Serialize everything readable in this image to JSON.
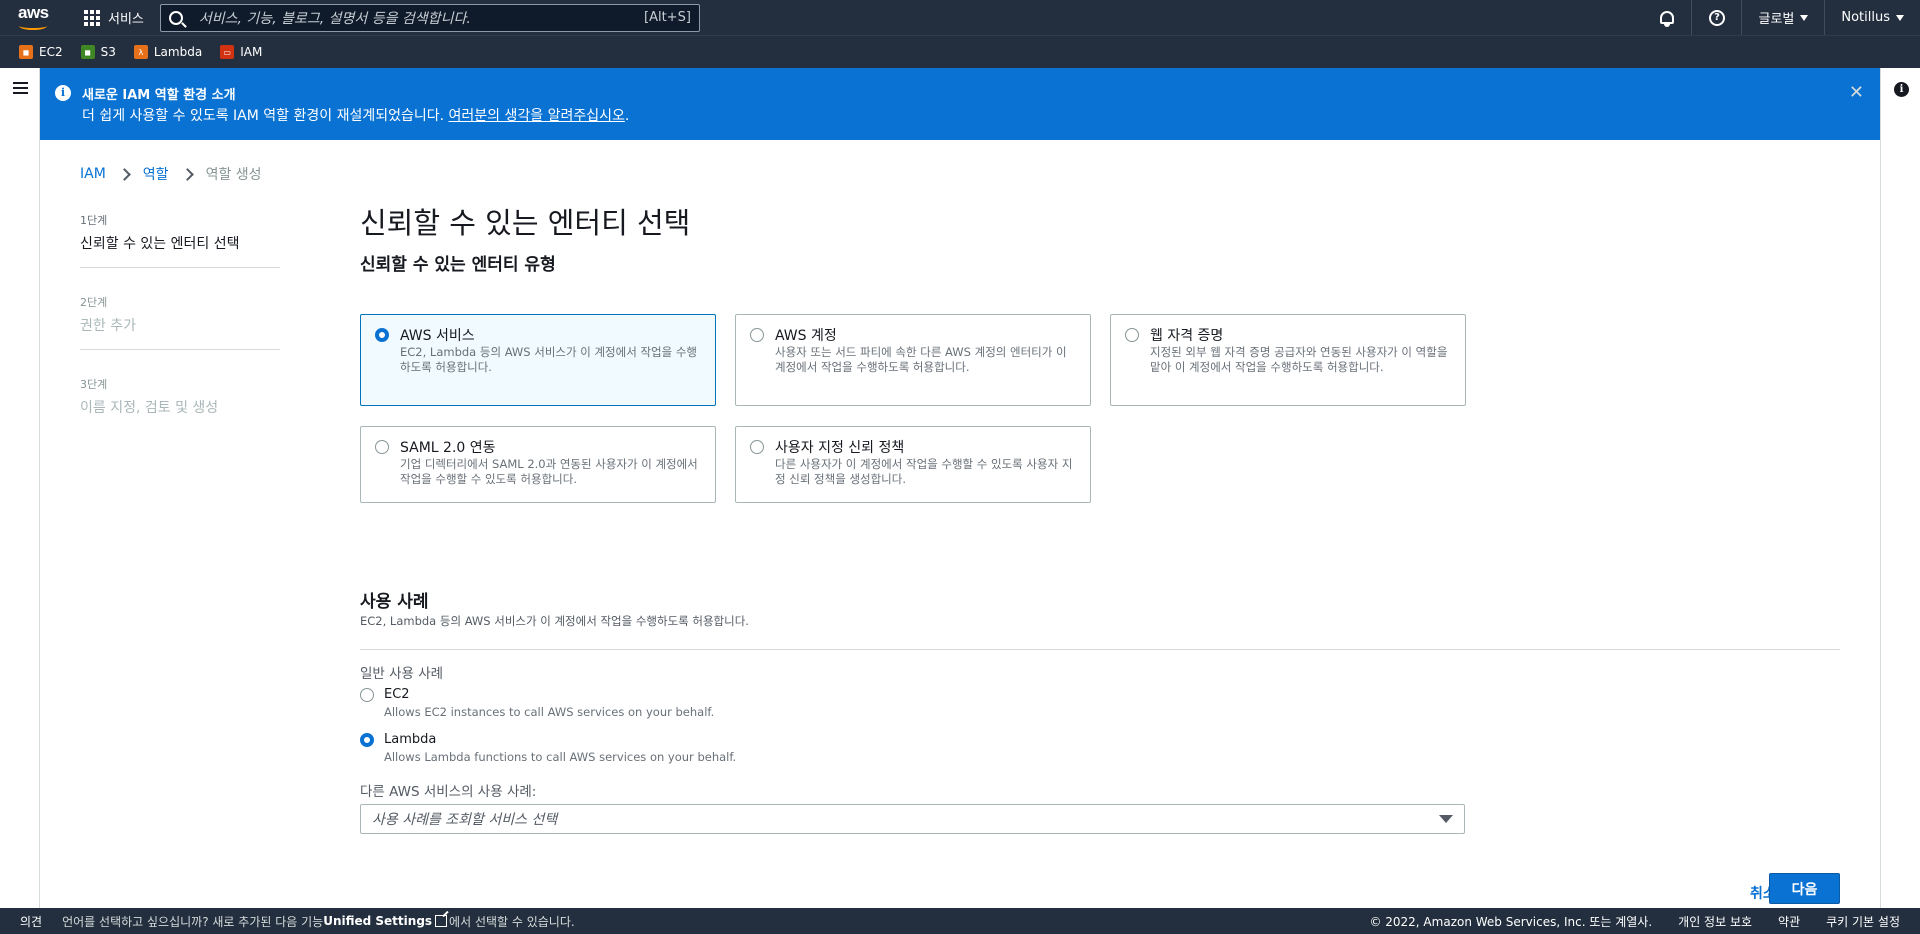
{
  "topnav": {
    "logo_text": "aws",
    "services_label": "서비스",
    "search_placeholder": "서비스, 기능, 블로그, 설명서 등을 검색합니다.",
    "search_shortcut": "[Alt+S]",
    "region_label": "글로벌",
    "account_label": "Notillus"
  },
  "favorites": [
    {
      "label": "EC2",
      "icon": "ec2-icon",
      "color": "#e7711b"
    },
    {
      "label": "S3",
      "icon": "s3-icon",
      "color": "#3f8624"
    },
    {
      "label": "Lambda",
      "icon": "lambda-icon",
      "color": "#e7711b"
    },
    {
      "label": "IAM",
      "icon": "iam-icon",
      "color": "#d13212"
    }
  ],
  "flash": {
    "title": "새로운 IAM 역할 환경 소개",
    "message": "더 쉽게 사용할 수 있도록 IAM 역할 환경이 재설계되었습니다. ",
    "link": "여러분의 생각을 알려주십시오",
    "suffix": "."
  },
  "breadcrumb": [
    "IAM",
    "역할",
    "역할 생성"
  ],
  "steps": [
    {
      "num": "1단계",
      "label": "신뢰할 수 있는 엔터티 선택"
    },
    {
      "num": "2단계",
      "label": "권한 추가"
    },
    {
      "num": "3단계",
      "label": "이름 지정, 검토 및 생성"
    }
  ],
  "page_title": "신뢰할 수 있는 엔터티 선택",
  "entity_section_title": "신뢰할 수 있는 엔터티 유형",
  "entity_types": [
    {
      "title": "AWS 서비스",
      "desc": "EC2, Lambda 등의 AWS 서비스가 이 계정에서 작업을 수행하도록 허용합니다.",
      "selected": true
    },
    {
      "title": "AWS 계정",
      "desc": "사용자 또는 서드 파티에 속한 다른 AWS 계정의 엔터티가 이 계정에서 작업을 수행하도록 허용합니다.",
      "selected": false
    },
    {
      "title": "웹 자격 증명",
      "desc": "지정된 외부 웹 자격 증명 공급자와 연동된 사용자가 이 역할을 맡아 이 계정에서 작업을 수행하도록 허용합니다.",
      "selected": false
    },
    {
      "title": "SAML 2.0 연동",
      "desc": "기업 디렉터리에서 SAML 2.0과 연동된 사용자가 이 계정에서 작업을 수행할 수 있도록 허용합니다.",
      "selected": false
    },
    {
      "title": "사용자 지정 신뢰 정책",
      "desc": "다른 사용자가 이 계정에서 작업을 수행할 수 있도록 사용자 지정 신뢰 정책을 생성합니다.",
      "selected": false
    }
  ],
  "use_case": {
    "title": "사용 사례",
    "desc": "EC2, Lambda 등의 AWS 서비스가 이 계정에서 작업을 수행하도록 허용합니다.",
    "general_label": "일반 사용 사례",
    "options": [
      {
        "title": "EC2",
        "desc": "Allows EC2 instances to call AWS services on your behalf.",
        "selected": false
      },
      {
        "title": "Lambda",
        "desc": "Allows Lambda functions to call AWS services on your behalf.",
        "selected": true
      }
    ],
    "other_label": "다른 AWS 서비스의 사용 사례:",
    "select_placeholder": "사용 사례를 조회할 서비스 선택"
  },
  "actions": {
    "cancel": "취소",
    "next": "다음"
  },
  "footer": {
    "feedback": "의견",
    "lang_prefix": "언어를 선택하고 싶으십니까? 새로 추가된 다음 기능",
    "lang_link": "Unified Settings",
    "lang_suffix": "에서 선택할 수 있습니다.",
    "copyright": "© 2022, Amazon Web Services, Inc. 또는 계열사.",
    "privacy": "개인 정보 보호",
    "terms": "약관",
    "cookies": "쿠키 기본 설정"
  },
  "colors": {
    "nav_bg": "#232f3e",
    "accent": "#0972d3",
    "flash_bg": "#0972d3",
    "selected_tile_bg": "#f1faff"
  }
}
